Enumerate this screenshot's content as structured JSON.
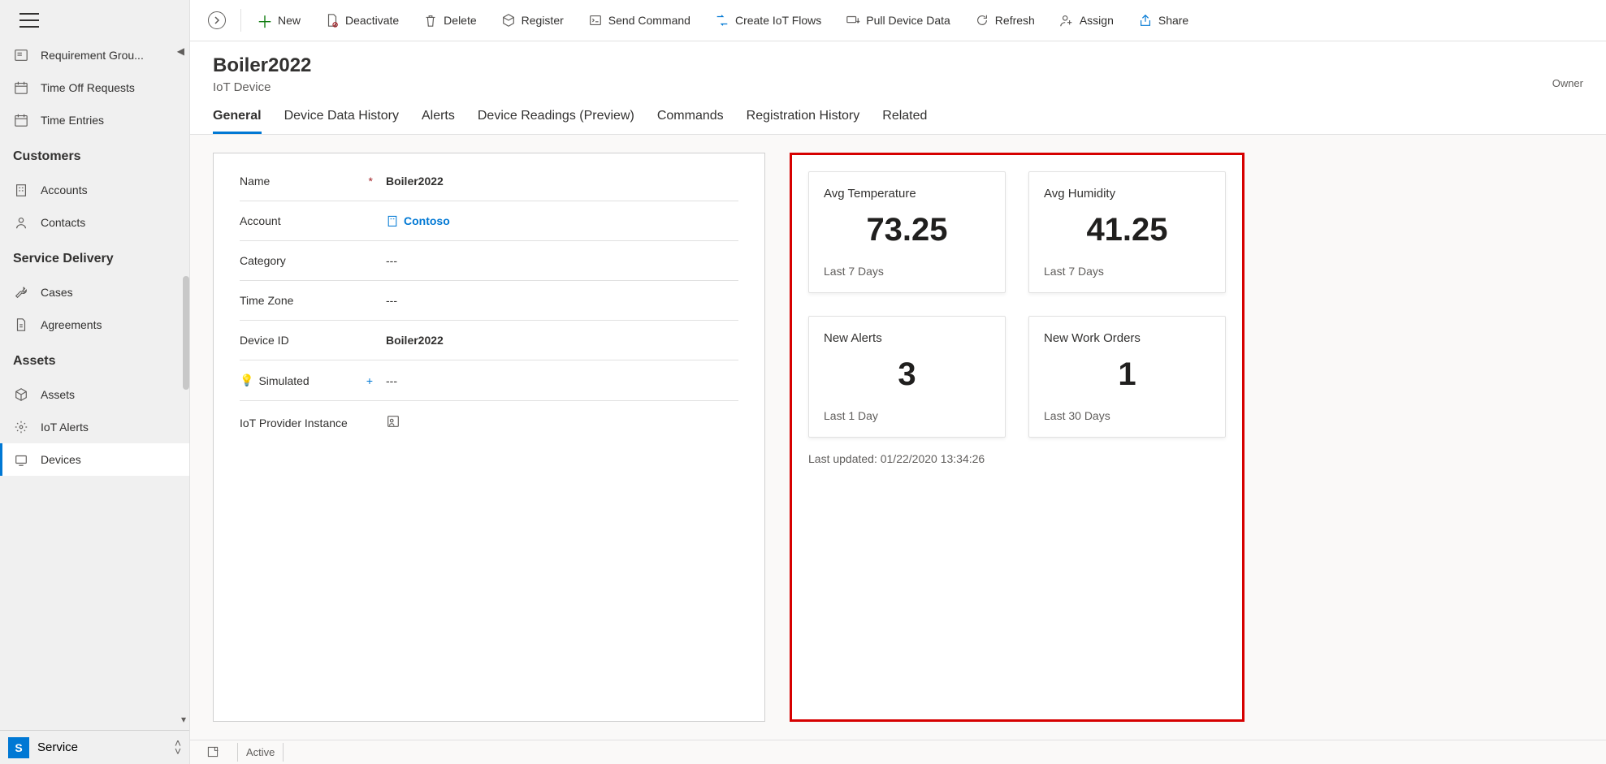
{
  "sidebar": {
    "items_top": [
      {
        "label": "Requirement Grou..."
      },
      {
        "label": "Time Off Requests"
      },
      {
        "label": "Time Entries"
      }
    ],
    "sections": [
      {
        "title": "Customers",
        "items": [
          {
            "label": "Accounts"
          },
          {
            "label": "Contacts"
          }
        ]
      },
      {
        "title": "Service Delivery",
        "items": [
          {
            "label": "Cases"
          },
          {
            "label": "Agreements"
          }
        ]
      },
      {
        "title": "Assets",
        "items": [
          {
            "label": "Assets"
          },
          {
            "label": "IoT Alerts"
          },
          {
            "label": "Devices"
          }
        ]
      }
    ],
    "app_badge": "S",
    "app_name": "Service"
  },
  "toolbar": {
    "new": "New",
    "deactivate": "Deactivate",
    "delete": "Delete",
    "register": "Register",
    "send_command": "Send Command",
    "create_flows": "Create IoT Flows",
    "pull_data": "Pull Device Data",
    "refresh": "Refresh",
    "assign": "Assign",
    "share": "Share"
  },
  "header": {
    "title": "Boiler2022",
    "subtitle": "IoT Device",
    "owner_label": "Owner"
  },
  "tabs": [
    "General",
    "Device Data History",
    "Alerts",
    "Device Readings (Preview)",
    "Commands",
    "Registration History",
    "Related"
  ],
  "form": {
    "name_label": "Name",
    "name_value": "Boiler2022",
    "account_label": "Account",
    "account_value": "Contoso",
    "category_label": "Category",
    "category_value": "---",
    "timezone_label": "Time Zone",
    "timezone_value": "---",
    "deviceid_label": "Device ID",
    "deviceid_value": "Boiler2022",
    "simulated_label": "Simulated",
    "simulated_value": "---",
    "provider_label": "IoT Provider Instance"
  },
  "summary": {
    "tiles": [
      {
        "title": "Avg Temperature",
        "value": "73.25",
        "footer": "Last 7 Days"
      },
      {
        "title": "Avg Humidity",
        "value": "41.25",
        "footer": "Last 7 Days"
      },
      {
        "title": "New Alerts",
        "value": "3",
        "footer": "Last 1 Day"
      },
      {
        "title": "New Work Orders",
        "value": "1",
        "footer": "Last 30 Days"
      }
    ],
    "last_updated": "Last updated: 01/22/2020 13:34:26"
  },
  "footer": {
    "status": "Active"
  }
}
